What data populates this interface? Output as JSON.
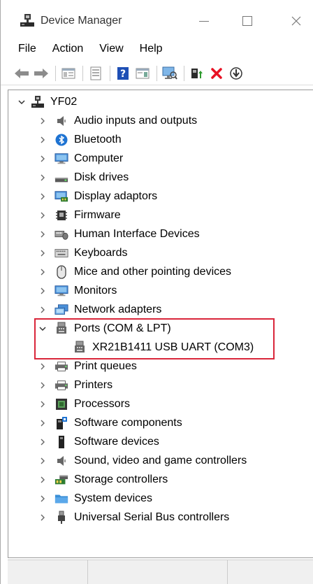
{
  "window": {
    "title": "Device Manager"
  },
  "menu": {
    "items": [
      "File",
      "Action",
      "View",
      "Help"
    ]
  },
  "toolbar": {
    "buttons": [
      "back-icon",
      "forward-icon",
      "show-hide-tree-icon",
      "properties-icon",
      "help-icon",
      "action-pane-icon",
      "scan-hardware-icon",
      "update-driver-icon",
      "uninstall-icon",
      "install-icon"
    ]
  },
  "tree": {
    "root": "YF02",
    "categories": [
      {
        "label": "Audio inputs and outputs",
        "icon": "speaker-icon"
      },
      {
        "label": "Bluetooth",
        "icon": "bluetooth-icon"
      },
      {
        "label": "Computer",
        "icon": "monitor-icon"
      },
      {
        "label": "Disk drives",
        "icon": "disk-drive-icon"
      },
      {
        "label": "Display adaptors",
        "icon": "display-adapter-icon"
      },
      {
        "label": "Firmware",
        "icon": "firmware-icon"
      },
      {
        "label": "Human Interface Devices",
        "icon": "hid-icon"
      },
      {
        "label": "Keyboards",
        "icon": "keyboard-icon"
      },
      {
        "label": "Mice and other pointing devices",
        "icon": "mouse-icon"
      },
      {
        "label": "Monitors",
        "icon": "monitor-icon"
      },
      {
        "label": "Network adapters",
        "icon": "network-icon"
      },
      {
        "label": "Ports (COM & LPT)",
        "icon": "port-icon",
        "expanded": true,
        "children": [
          "XR21B1411 USB UART (COM3)"
        ]
      },
      {
        "label": "Print queues",
        "icon": "printer-icon"
      },
      {
        "label": "Printers",
        "icon": "printer-icon"
      },
      {
        "label": "Processors",
        "icon": "processor-icon"
      },
      {
        "label": "Software components",
        "icon": "software-component-icon"
      },
      {
        "label": "Software devices",
        "icon": "software-device-icon"
      },
      {
        "label": "Sound, video and game controllers",
        "icon": "speaker-icon"
      },
      {
        "label": "Storage controllers",
        "icon": "storage-controller-icon"
      },
      {
        "label": "System devices",
        "icon": "system-folder-icon"
      },
      {
        "label": "Universal Serial Bus controllers",
        "icon": "usb-icon"
      }
    ]
  },
  "colors": {
    "highlight_border": "#d9263a",
    "accent_blue": "#1e73d2",
    "uninstall_red": "#e81123",
    "scan_green": "#2e9b2e"
  }
}
